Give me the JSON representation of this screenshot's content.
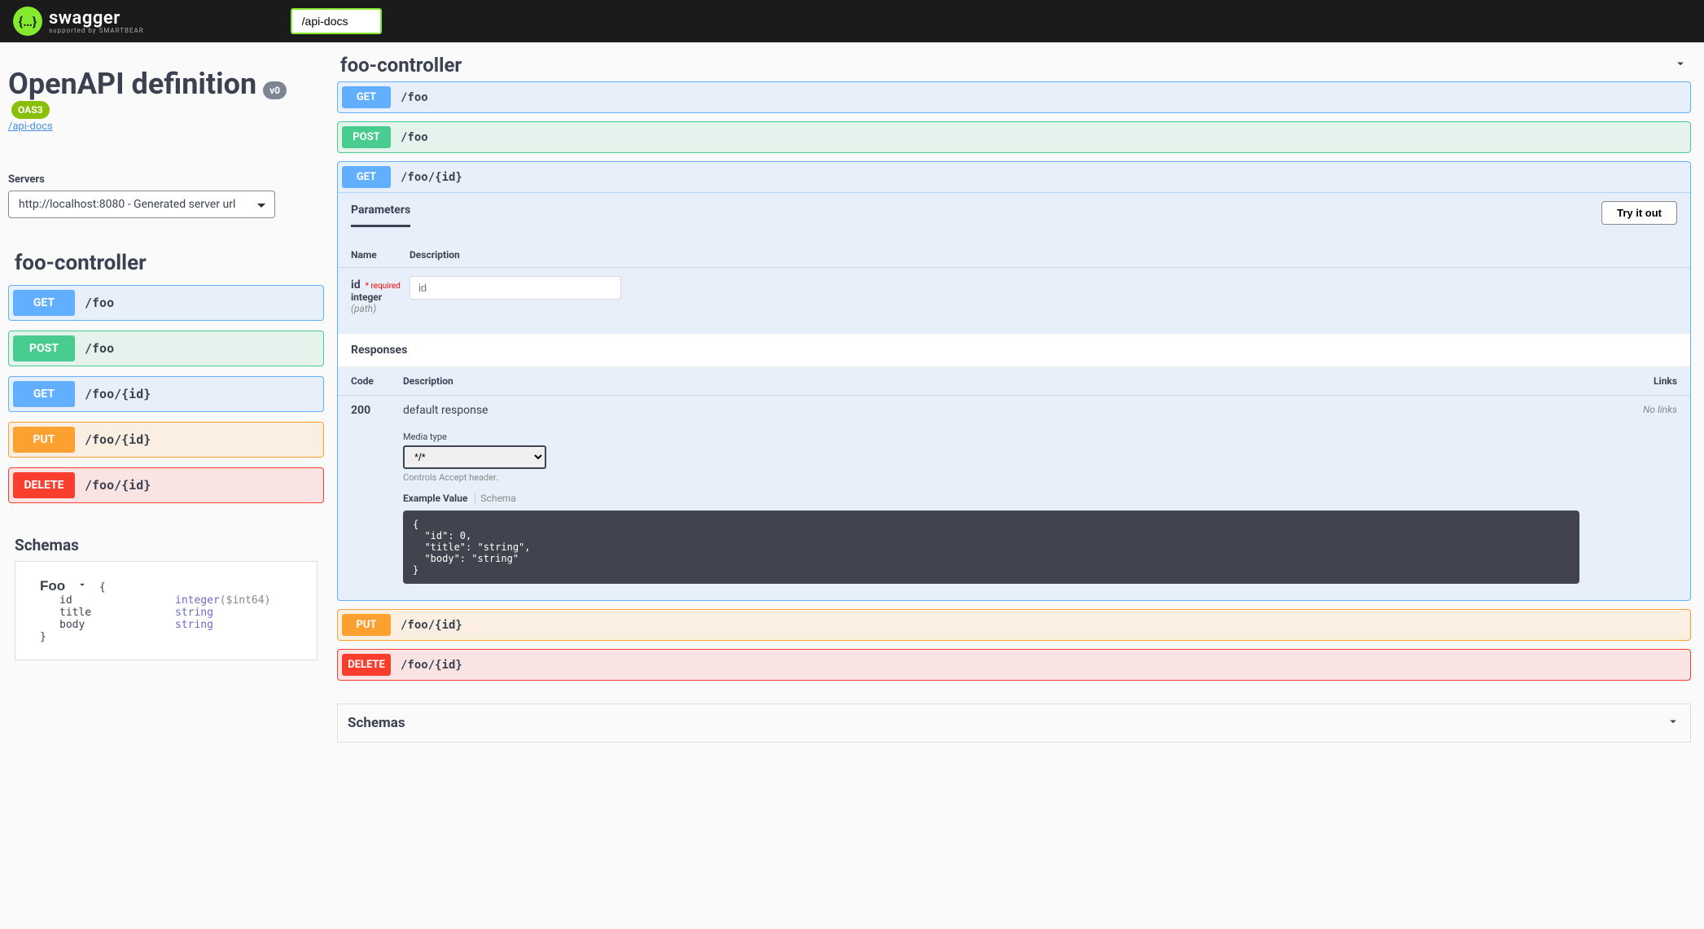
{
  "topbar": {
    "brand_text": "swagger",
    "brand_sub": "supported by SMARTBEAR",
    "url_value": "/api-docs"
  },
  "header": {
    "title": "OpenAPI definition",
    "version_badge": "v0",
    "oas_badge": "OAS3",
    "link": "/api-docs"
  },
  "servers": {
    "label": "Servers",
    "selected": "http://localhost:8080 - Generated server url"
  },
  "left": {
    "section_title": "foo-controller",
    "ops": [
      {
        "method": "GET",
        "cls": "get",
        "path": "/foo"
      },
      {
        "method": "POST",
        "cls": "post",
        "path": "/foo"
      },
      {
        "method": "GET",
        "cls": "get",
        "path": "/foo/{id}"
      },
      {
        "method": "PUT",
        "cls": "put",
        "path": "/foo/{id}"
      },
      {
        "method": "DELETE",
        "cls": "delete",
        "path": "/foo/{id}"
      }
    ],
    "schemas_title": "Schemas",
    "schema": {
      "name": "Foo",
      "props": [
        {
          "key": "id",
          "type": "integer",
          "format": "($int64)"
        },
        {
          "key": "title",
          "type": "string",
          "format": ""
        },
        {
          "key": "body",
          "type": "string",
          "format": ""
        }
      ]
    }
  },
  "right": {
    "section_title": "foo-controller",
    "ops": [
      {
        "method": "GET",
        "cls": "get",
        "path": "/foo"
      },
      {
        "method": "POST",
        "cls": "post",
        "path": "/foo"
      }
    ],
    "expanded": {
      "method": "GET",
      "cls": "get",
      "path": "/foo/{id}",
      "parameters_label": "Parameters",
      "try_label": "Try it out",
      "cols": {
        "name": "Name",
        "desc": "Description"
      },
      "param": {
        "name": "id",
        "required_label": "* required",
        "type": "integer",
        "in": "(path)",
        "placeholder": "id"
      },
      "responses_label": "Responses",
      "resp_cols": {
        "code": "Code",
        "desc": "Description",
        "links": "Links"
      },
      "resp": {
        "code": "200",
        "desc": "default response",
        "no_links": "No links",
        "media_label": "Media type",
        "media_value": "*/*",
        "media_hint": "Controls Accept header.",
        "example_tab": "Example Value",
        "schema_tab": "Schema",
        "example_code": "{\n  \"id\": 0,\n  \"title\": \"string\",\n  \"body\": \"string\"\n}"
      }
    },
    "ops_after": [
      {
        "method": "PUT",
        "cls": "put",
        "path": "/foo/{id}"
      },
      {
        "method": "DELETE",
        "cls": "delete",
        "path": "/foo/{id}"
      }
    ],
    "schemas_title": "Schemas"
  }
}
